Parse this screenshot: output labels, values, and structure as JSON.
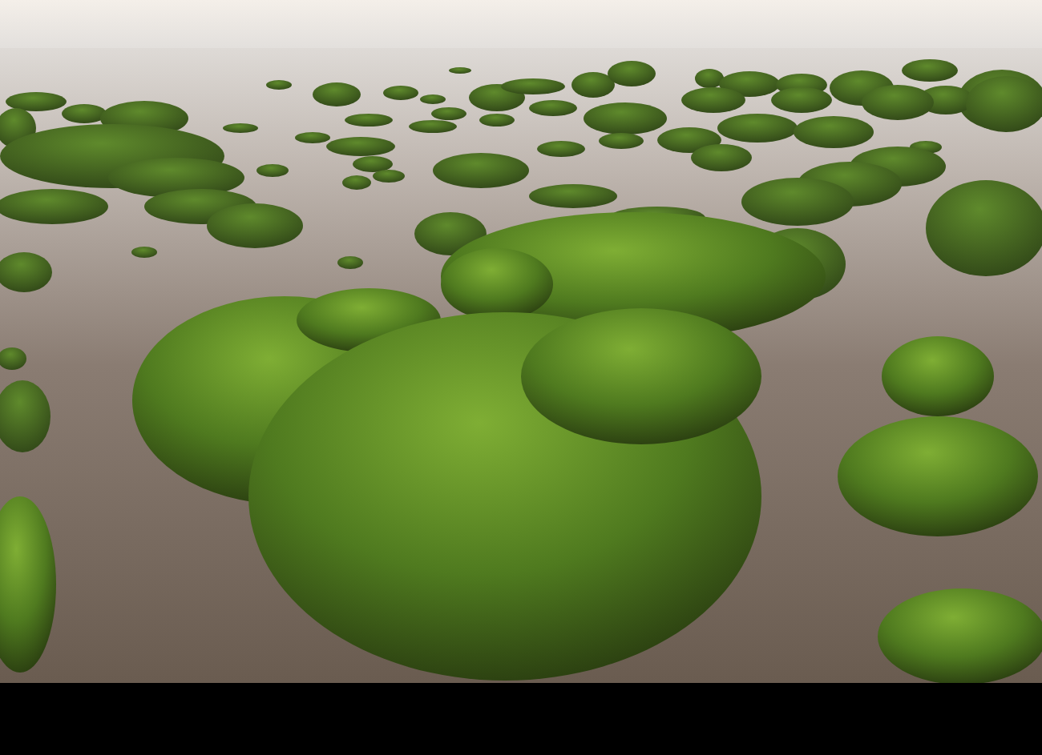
{
  "photo": {
    "kind": "photo"
  }
}
